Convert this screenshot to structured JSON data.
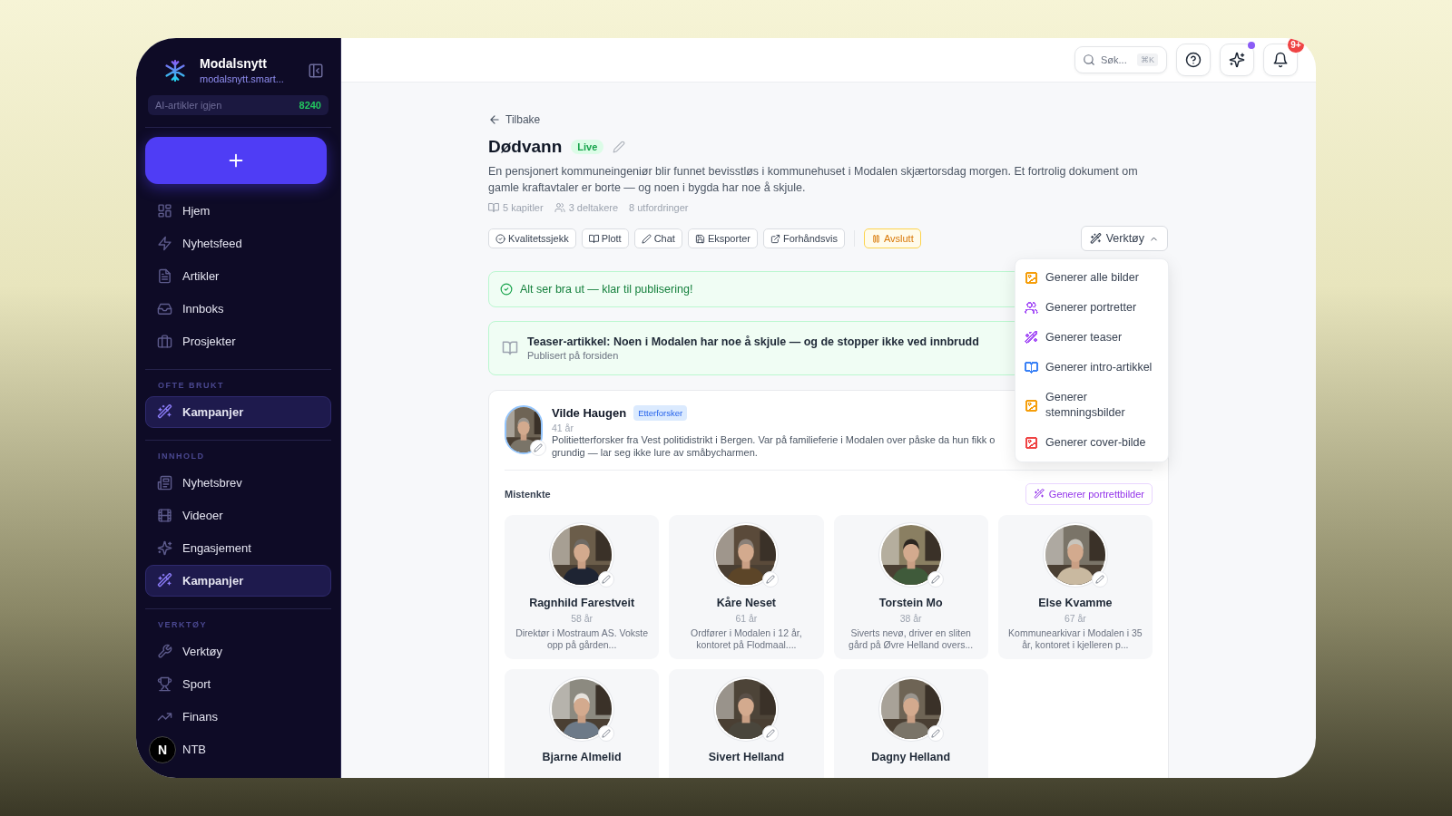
{
  "sidebar": {
    "brand": {
      "name": "Modalsnytt",
      "domain": "modalsnytt.smart..."
    },
    "credits": {
      "label": "AI-artikler igjen",
      "value": "8240"
    },
    "nav": [
      {
        "label": "Hjem",
        "selected": false
      },
      {
        "label": "Nyhetsfeed",
        "selected": false
      },
      {
        "label": "Artikler",
        "selected": false
      },
      {
        "label": "Innboks",
        "selected": false
      },
      {
        "label": "Prosjekter",
        "selected": false
      }
    ],
    "sections": [
      {
        "heading": "OFTE BRUKT",
        "items": [
          {
            "label": "Kampanjer",
            "selected": true
          }
        ]
      },
      {
        "heading": "INNHOLD",
        "items": [
          {
            "label": "Nyhetsbrev",
            "selected": false
          },
          {
            "label": "Videoer",
            "selected": false
          },
          {
            "label": "Engasjement",
            "selected": false
          },
          {
            "label": "Kampanjer",
            "selected": true
          }
        ]
      },
      {
        "heading": "VERKTØY",
        "items": [
          {
            "label": "Verktøy",
            "selected": false
          },
          {
            "label": "Sport",
            "selected": false
          },
          {
            "label": "Finans",
            "selected": false
          },
          {
            "label": "NTB",
            "selected": false
          }
        ]
      }
    ],
    "dev_badge": "N"
  },
  "topbar": {
    "search": {
      "placeholder": "Søk...",
      "shortcut": "⌘K"
    },
    "notifications": "9+",
    "assistant_unread": true
  },
  "back": "Tilbake",
  "title": "Dødvann",
  "status": "Live",
  "description": "En pensjonert kommuneingeniør blir funnet bevisstløs i kommunehuset i Modalen skjærtorsdag morgen. Et fortrolig dokument om gamle kraftavtaler er borte — og noen i bygda har noe å skjule.",
  "meta": [
    "5 kapitler",
    "3 deltakere",
    "8 utfordringer"
  ],
  "actions": [
    {
      "label": "Kvalitetssjekk",
      "kind": "normal"
    },
    {
      "label": "Plott",
      "kind": "normal"
    },
    {
      "label": "Chat",
      "kind": "normal"
    },
    {
      "label": "Eksporter",
      "kind": "normal"
    },
    {
      "label": "Forhåndsvis",
      "kind": "normal"
    },
    {
      "label": "Avslutt",
      "kind": "warning"
    }
  ],
  "tools": {
    "label": "Verktøy",
    "expanded": true,
    "items": [
      {
        "label": "Generer alle bilder",
        "color": "#f59e0b"
      },
      {
        "label": "Generer portretter",
        "color": "#a855f7"
      },
      {
        "label": "Generer teaser",
        "color": "#a855f7"
      },
      {
        "label": "Generer intro-artikkel",
        "color": "#3b82f6"
      },
      {
        "label": "Generer stemningsbilder",
        "color": "#f59e0b"
      },
      {
        "label": "Generer cover-bilde",
        "color": "#ef4444"
      }
    ]
  },
  "alert": "Alt ser bra ut — klar til publisering!",
  "teaser": {
    "title": "Teaser-artikkel: Noen i Modalen har noe å skjule — og de stopper ikke ved innbrudd",
    "subtitle": "Publisert på forsiden"
  },
  "lead": {
    "name": "Vilde Haugen",
    "role": "Etterforsker",
    "age": "41 år",
    "description": [
      "Politietterforsker fra Vest politidistrikt i Bergen. Var på familieferie i Modalen over påske da hun fikk o",
      "grundig — lar seg ikke lure av småbycharmen."
    ]
  },
  "suspects": {
    "heading": "Mistenkte",
    "button": "Generer portrettbilder",
    "cards": [
      {
        "name": "Ragnhild Farestveit",
        "age": "58 år",
        "description": "Direktør i Mostraum AS. Vokste opp på gården..."
      },
      {
        "name": "Kåre Neset",
        "age": "61 år",
        "description": "Ordfører i Modalen i 12 år, kontoret på Flodmaal...."
      },
      {
        "name": "Torstein Mo",
        "age": "38 år",
        "description": "Siverts nevø, driver en sliten gård på Øvre Helland overs..."
      },
      {
        "name": "Else Kvamme",
        "age": "67 år",
        "description": "Kommunearkivar i Modalen i 35 år, kontoret i kjelleren p..."
      },
      {
        "name": "Bjarne Almelid"
      },
      {
        "name": "Sivert Helland"
      },
      {
        "name": "Dagny Helland"
      }
    ]
  }
}
